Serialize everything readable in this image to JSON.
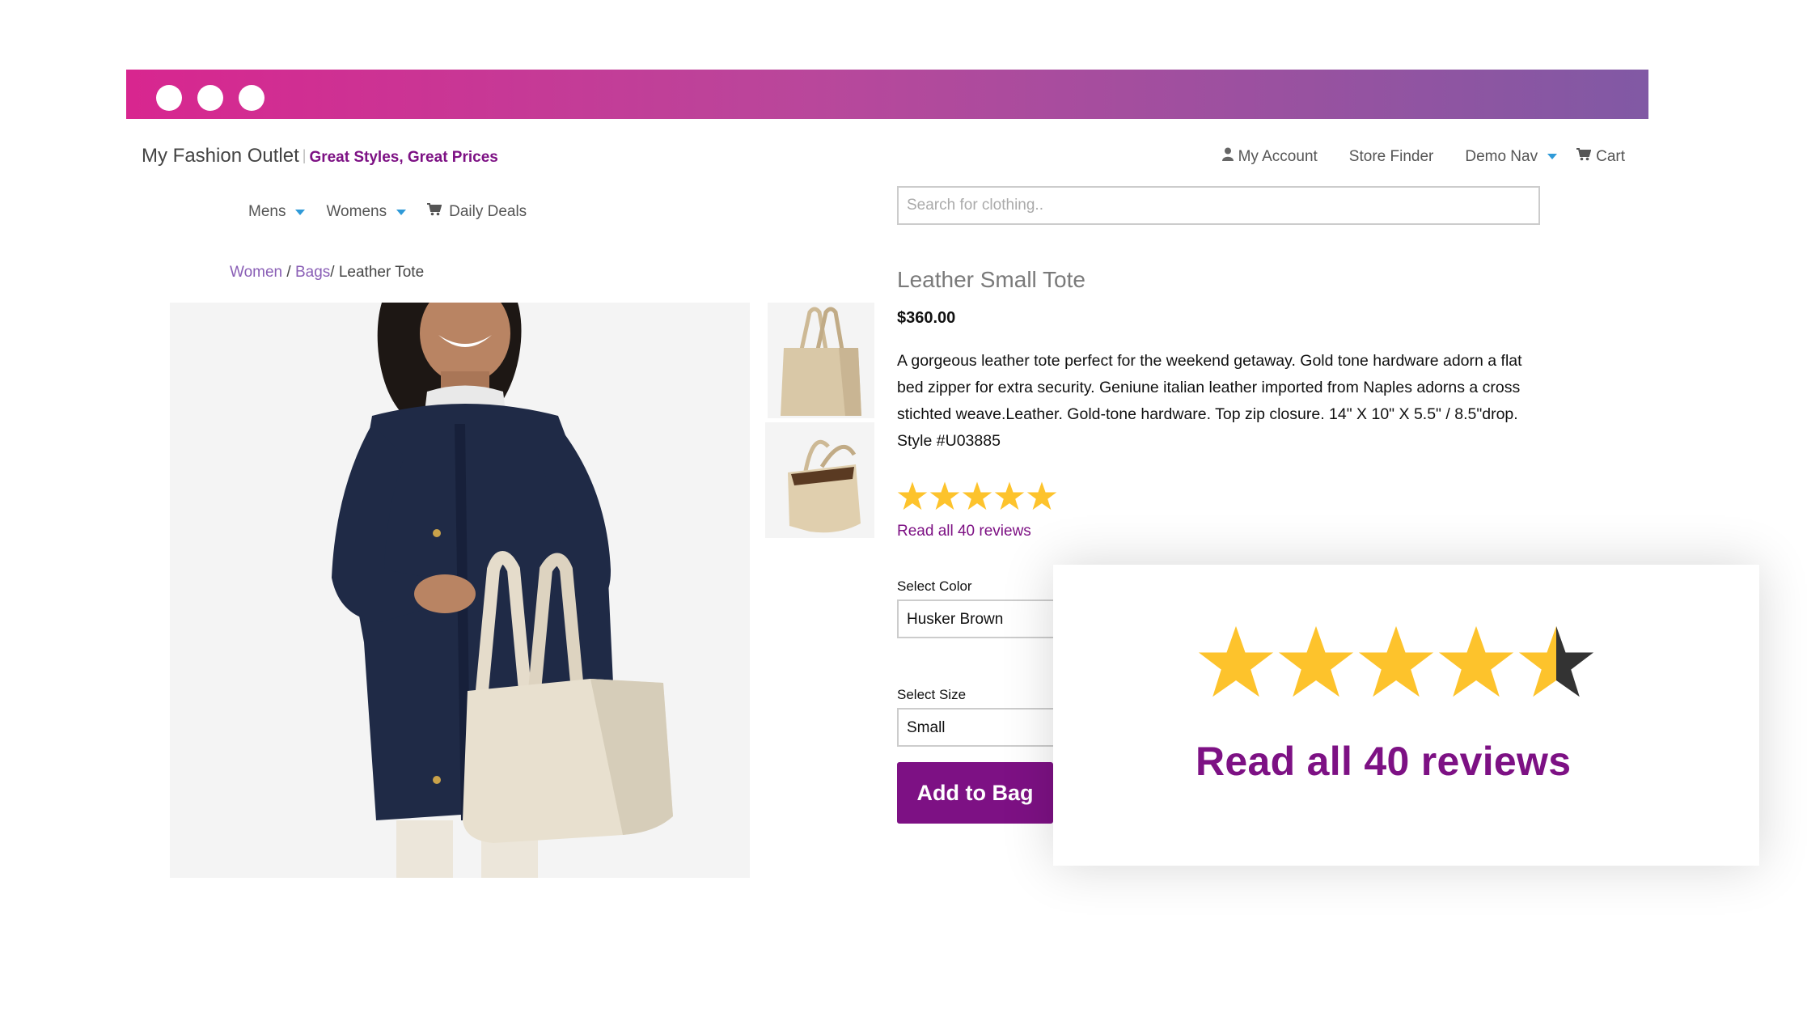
{
  "store": {
    "name": "My Fashion Outlet",
    "tagline": "Great Styles, Great Prices"
  },
  "top_nav": {
    "account": "My Account",
    "store_finder": "Store Finder",
    "demo_nav": "Demo Nav",
    "cart": "Cart"
  },
  "main_nav": {
    "mens": "Mens",
    "womens": "Womens",
    "daily_deals": "Daily Deals"
  },
  "search": {
    "placeholder": "Search for clothing.."
  },
  "breadcrumb": {
    "level1": "Women",
    "sep1": " / ",
    "level2": "Bags",
    "sep2": "/ ",
    "current": "Leather Tote"
  },
  "product": {
    "title": "Leather Small Tote",
    "price": "$360.00",
    "description": "A gorgeous leather tote perfect for the weekend getaway. Gold tone hardware adorn a flat bed zipper for extra security. Geniune italian leather imported from Naples adorns a cross stichted weave.Leather. Gold-tone hardware. Top zip closure. 14\" X 10\" X 5.5\" / 8.5\"drop. Style #U03885",
    "rating_small": 5,
    "reviews_link": "Read all 40 reviews",
    "color_label": "Select Color",
    "color_value": "Husker Brown",
    "size_label": "Select Size",
    "size_value": "Small",
    "add_button": "Add to Bag"
  },
  "popup": {
    "rating": 4.5,
    "reviews_link": "Read all 40 reviews"
  },
  "colors": {
    "brand_purple": "#7d1184",
    "link_purple": "#8a5fb6",
    "star_gold": "#fdc32c",
    "star_dark": "#333333",
    "caret_blue": "#2f9ad8"
  },
  "icons": {
    "account": "user-icon",
    "cart": "cart-icon",
    "deals": "cart-icon"
  }
}
